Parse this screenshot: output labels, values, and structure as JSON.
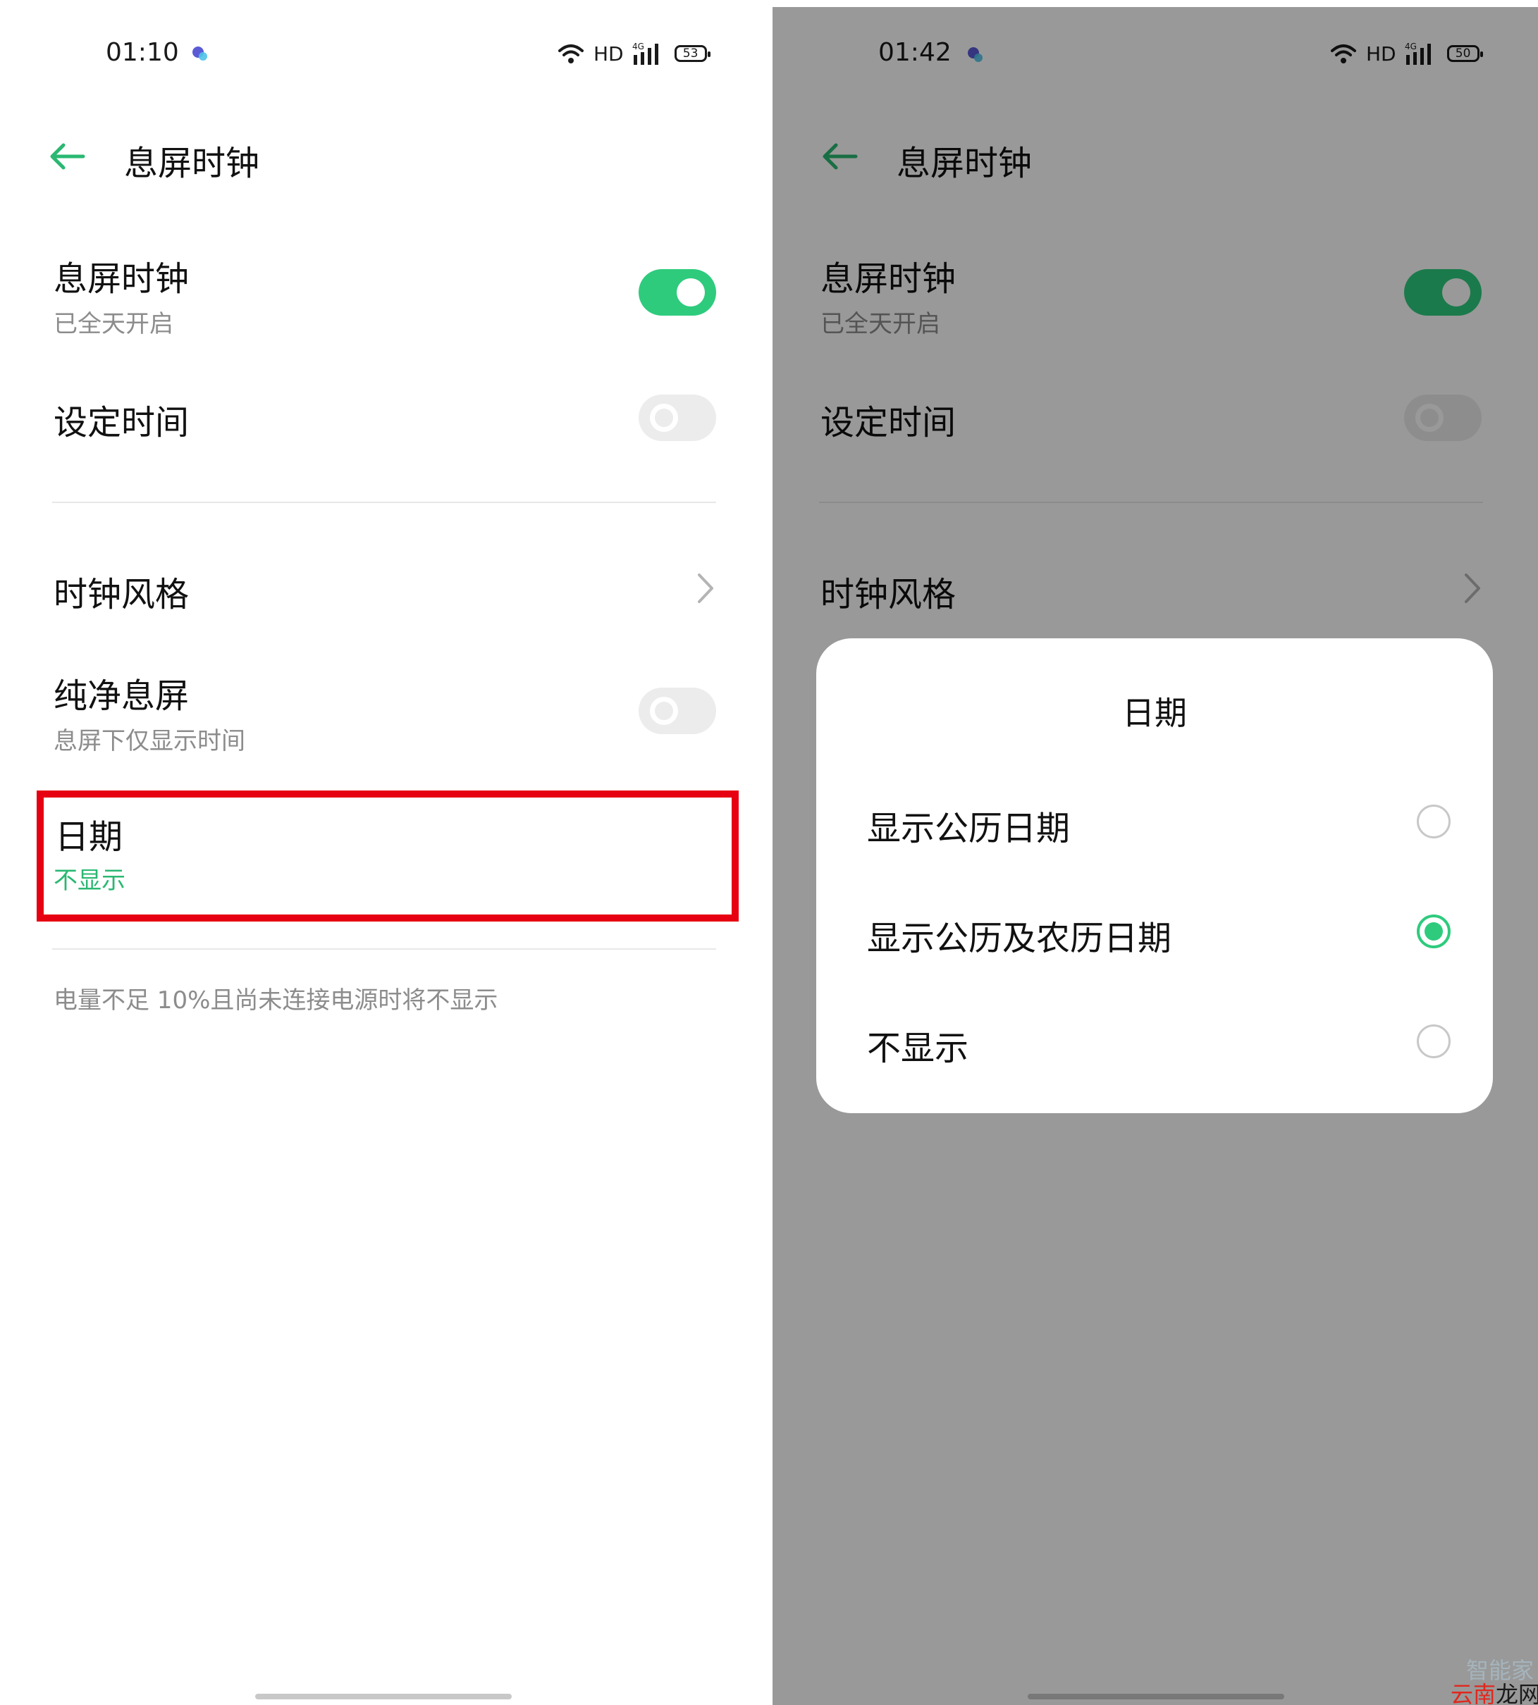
{
  "screen_left": {
    "status_bar": {
      "time": "01:10",
      "network": "HD",
      "signal_type": "4G",
      "battery": "53"
    },
    "header": {
      "back_icon": "arrow-left-icon",
      "title": "息屏时钟"
    },
    "items": [
      {
        "title": "息屏时钟",
        "subtitle": "已全天开启",
        "control": "toggle",
        "state": "on"
      },
      {
        "title": "设定时间",
        "control": "toggle",
        "state": "off"
      },
      {
        "title": "时钟风格",
        "control": "chevron"
      },
      {
        "title": "纯净息屏",
        "subtitle": "息屏下仅显示时间",
        "control": "toggle",
        "state": "off"
      },
      {
        "title": "日期",
        "subtitle": "不显示"
      }
    ],
    "footnote": "电量不足 10%且尚未连接电源时将不显示"
  },
  "screen_right": {
    "status_bar": {
      "time": "01:42",
      "network": "HD",
      "signal_type": "4G",
      "battery": "50"
    },
    "header": {
      "back_icon": "arrow-left-icon",
      "title": "息屏时钟"
    },
    "items": [
      {
        "title": "息屏时钟",
        "subtitle": "已全天开启",
        "control": "toggle",
        "state": "on"
      },
      {
        "title": "设定时间",
        "control": "toggle",
        "state": "off"
      },
      {
        "title": "时钟风格",
        "control": "chevron"
      }
    ],
    "dialog": {
      "title": "日期",
      "options": [
        {
          "label": "显示公历日期",
          "selected": false
        },
        {
          "label": "显示公历及农历日期",
          "selected": true
        },
        {
          "label": "不显示",
          "selected": false
        }
      ]
    }
  },
  "watermark": {
    "line1": "智能家",
    "line2a": "云南",
    "line2b": "龙网"
  },
  "colors": {
    "accent_green": "#2ecb7d",
    "highlight_red": "#e60012",
    "subtext_gray": "#8c8c8c"
  }
}
